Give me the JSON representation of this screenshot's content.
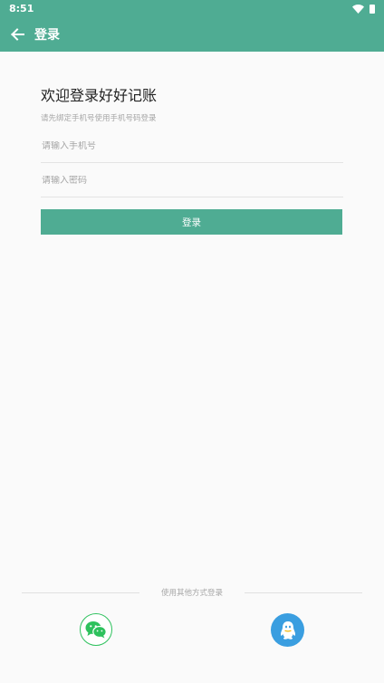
{
  "statusbar": {
    "time": "8:51"
  },
  "appbar": {
    "title": "登录"
  },
  "welcome": {
    "title": "欢迎登录好好记账",
    "subtitle": "请先绑定手机号使用手机号码登录"
  },
  "form": {
    "phone_placeholder": "请输入手机号",
    "password_placeholder": "请输入密码",
    "login_label": "登录"
  },
  "other": {
    "label": "使用其他方式登录"
  },
  "colors": {
    "primary": "#4fac93",
    "wechat": "#2ec15d",
    "qq": "#3a9ee0"
  },
  "icons": [
    "back-arrow-icon",
    "wifi-icon",
    "battery-icon",
    "wechat-icon",
    "qq-icon"
  ]
}
